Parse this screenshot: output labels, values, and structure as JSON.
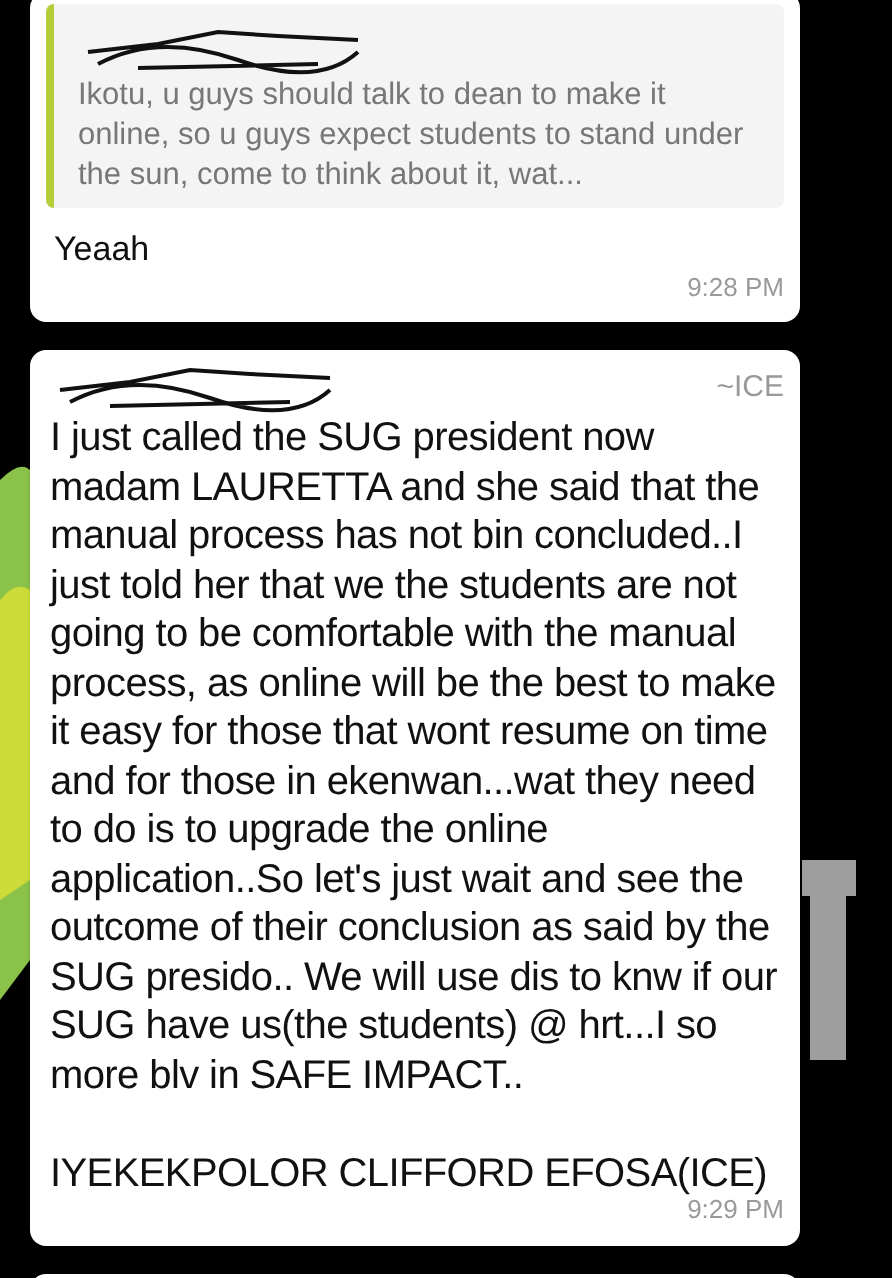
{
  "messages": [
    {
      "quote": {
        "text": "Ikotu, u guys should talk to dean to make it online, so u guys expect students to stand under the sun, come to think about it, wat..."
      },
      "text": "Yeaah",
      "time": "9:28 PM"
    },
    {
      "sender_alias": "~ICE",
      "text": "I just called the SUG president now madam LAURETTA and she said  that the  manual process has not bin concluded..I just told her that we the students are not going to be comfortable with the manual process, as online will be the best to make it easy for those that wont resume on time and for those in ekenwan...wat they need to do is to upgrade the online application..So let's just wait and see the outcome of their conclusion as said by the SUG presido.. We will use dis to knw if our SUG have us(the students) @ hrt...I so more blv in SAFE IMPACT..\n\nIYEKEKPOLOR CLIFFORD EFOSA(ICE)",
      "time": "9:29 PM"
    }
  ]
}
